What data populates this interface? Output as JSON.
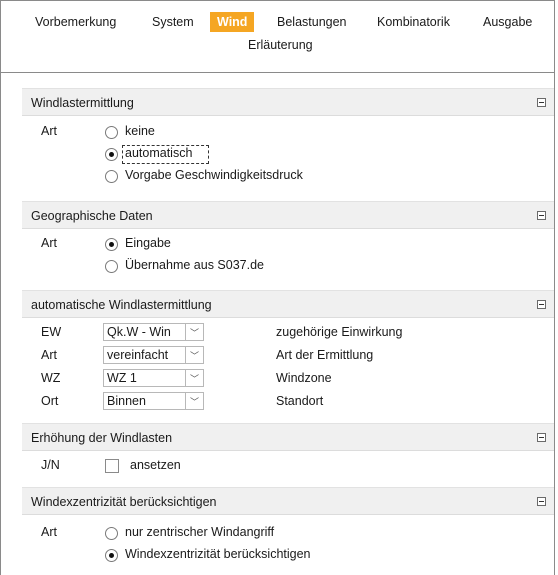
{
  "tabs": {
    "vorbemerkung": "Vorbemerkung",
    "system": "System",
    "wind": "Wind",
    "belastungen": "Belastungen",
    "kombinatorik": "Kombinatorik",
    "ausgabe": "Ausgabe",
    "erlaeuterung": "Erläuterung",
    "active": "Wind"
  },
  "sections": {
    "windlastermittlung": {
      "title": "Windlastermittlung",
      "art_label": "Art",
      "options": [
        "keine",
        "automatisch",
        "Vorgabe Geschwindigkeitsdruck"
      ],
      "selected": "automatisch"
    },
    "geographische_daten": {
      "title": "Geographische Daten",
      "art_label": "Art",
      "options": [
        "Eingabe",
        "Übernahme aus S037.de"
      ],
      "selected": "Eingabe"
    },
    "automatische": {
      "title": "automatische Windlastermittlung",
      "rows": [
        {
          "label": "EW",
          "value": "Qk.W - Win",
          "description": "zugehörige Einwirkung"
        },
        {
          "label": "Art",
          "value": "vereinfacht",
          "description": "Art der Ermittlung"
        },
        {
          "label": "WZ",
          "value": "WZ 1",
          "description": "Windzone"
        },
        {
          "label": "Ort",
          "value": "Binnen",
          "description": "Standort"
        }
      ]
    },
    "erhoehung": {
      "title": "Erhöhung der Windlasten",
      "label": "J/N",
      "checkbox_label": "ansetzen",
      "checked": false
    },
    "exzentrizitaet": {
      "title": "Windexzentrizität berücksichtigen",
      "art_label": "Art",
      "options": [
        "nur zentrischer Windangriff",
        "Windexzentrizität berücksichtigen"
      ],
      "selected": "Windexzentrizität berücksichtigen"
    }
  },
  "icons": {
    "collapse": "minus-box-icon",
    "dropdown": "chevron-down-icon"
  },
  "colors": {
    "active_tab": "#f5a623",
    "section_header_bg": "#f0f0f0"
  }
}
